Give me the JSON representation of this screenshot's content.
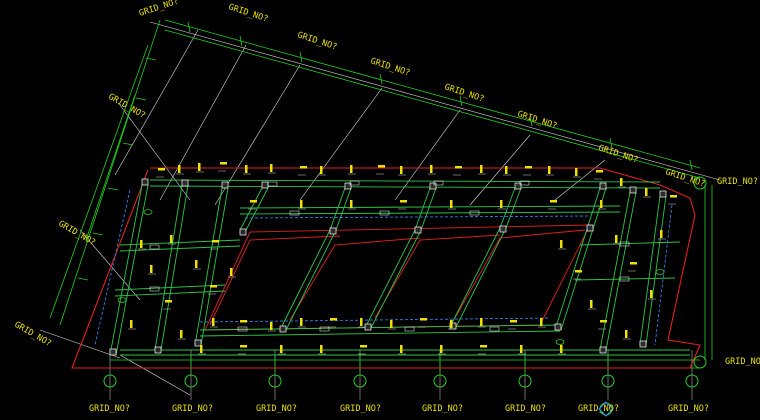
{
  "grid_label": "GRID_NO?",
  "colors": {
    "background": "#000000",
    "grid_line": "#d8d8d8",
    "dimension_line": "#22d022",
    "beam_line": "#2ac84a",
    "outline": "#e02020",
    "accent_blue": "#3a8cff",
    "annotation": "#f0e000"
  }
}
